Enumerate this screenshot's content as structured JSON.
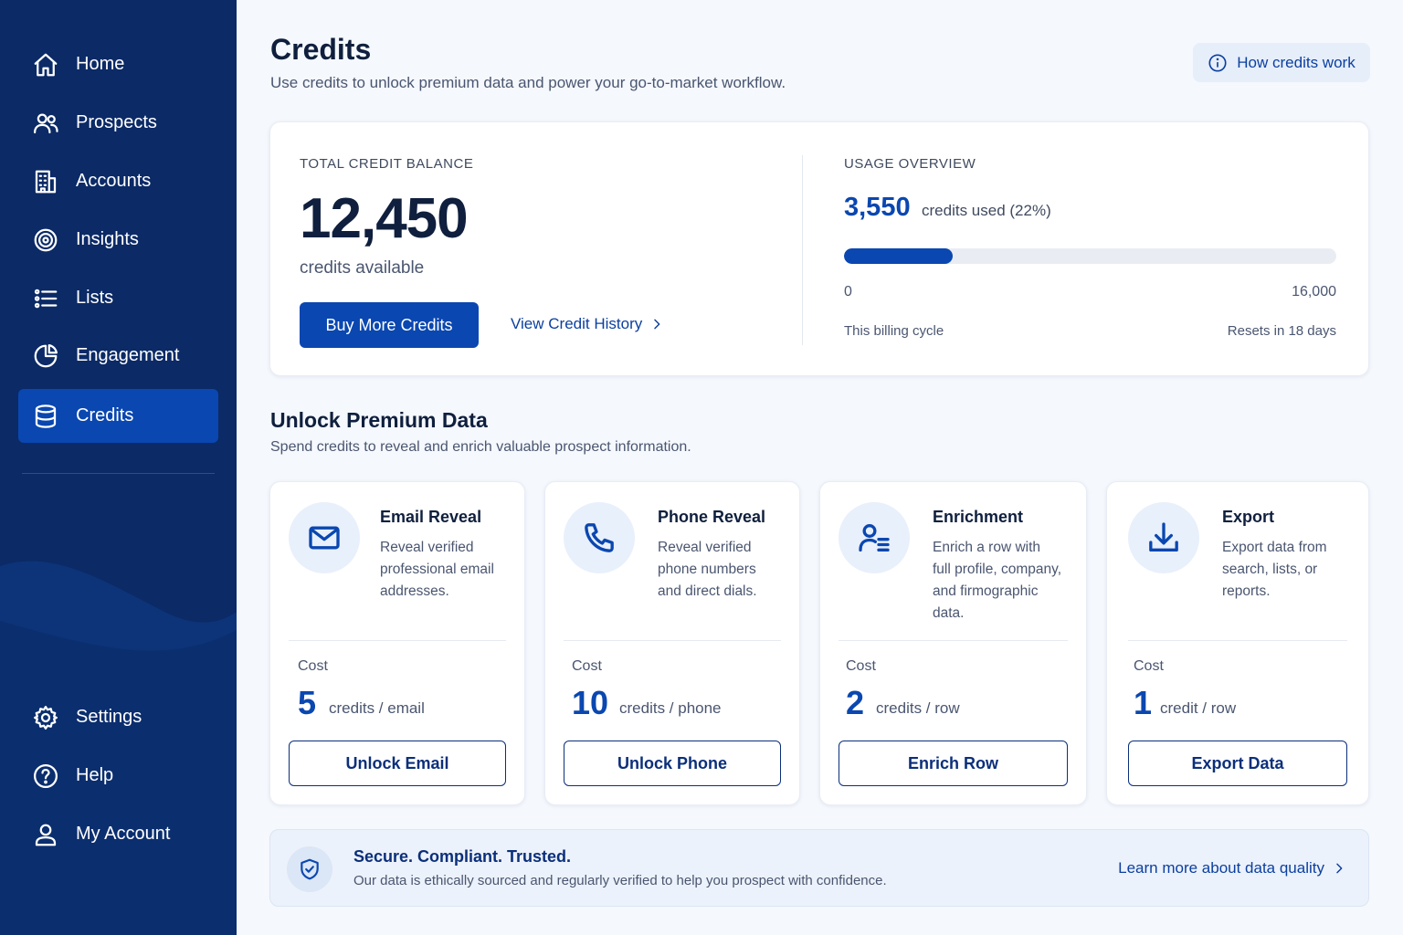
{
  "sidebar": {
    "items": [
      {
        "label": "Home",
        "icon": "home-icon"
      },
      {
        "label": "Prospects",
        "icon": "users-icon"
      },
      {
        "label": "Accounts",
        "icon": "building-icon"
      },
      {
        "label": "Insights",
        "icon": "target-icon"
      },
      {
        "label": "Lists",
        "icon": "list-icon"
      },
      {
        "label": "Engagement",
        "icon": "pie-chart-icon"
      },
      {
        "label": "Credits",
        "icon": "database-icon",
        "active": true
      }
    ],
    "bottom_items": [
      {
        "label": "Settings",
        "icon": "gear-icon"
      },
      {
        "label": "Help",
        "icon": "help-icon"
      },
      {
        "label": "My Account",
        "icon": "user-icon"
      }
    ]
  },
  "header": {
    "title": "Credits",
    "subtitle": "Use credits to unlock premium data and power your go-to-market workflow.",
    "how_button": "How credits work"
  },
  "balance": {
    "label": "TOTAL CREDIT BALANCE",
    "value": "12,450",
    "caption": "credits available",
    "buy_button": "Buy More Credits",
    "history_link": "View Credit History"
  },
  "usage": {
    "label": "USAGE OVERVIEW",
    "used": "3,550",
    "used_text": "credits used (22%)",
    "fraction": 0.22,
    "min": "0",
    "max": "16,000",
    "cycle": "This billing cycle",
    "resets": "Resets in 18 days"
  },
  "section": {
    "title": "Unlock Premium Data",
    "subtitle": "Spend credits to reveal and enrich valuable prospect information."
  },
  "features": [
    {
      "title": "Email Reveal",
      "desc": [
        "Reveal verified",
        "professional email",
        "addresses."
      ],
      "cost_label": "Cost",
      "cost": "5",
      "unit": "credits / email",
      "button": "Unlock Email",
      "icon": "mail-icon"
    },
    {
      "title": "Phone Reveal",
      "desc": [
        "Reveal verified",
        "phone numbers",
        "and direct dials."
      ],
      "cost_label": "Cost",
      "cost": "10",
      "unit": "credits / phone",
      "button": "Unlock Phone",
      "icon": "phone-icon"
    },
    {
      "title": "Enrichment",
      "desc": [
        "Enrich a row with",
        "full profile, company,",
        "and firmographic",
        "data."
      ],
      "cost_label": "Cost",
      "cost": "2",
      "unit": "credits / row",
      "button": "Enrich Row",
      "icon": "user-list-icon"
    },
    {
      "title": "Export",
      "desc": [
        "Export data from",
        "search, lists, or",
        "reports."
      ],
      "cost_label": "Cost",
      "cost": "1",
      "unit": "credit / row",
      "button": "Export Data",
      "icon": "download-icon"
    }
  ],
  "trust": {
    "title": "Secure. Compliant. Trusted.",
    "subtitle": "Our data is ethically sourced and regularly verified to help you prospect with confidence.",
    "link": "Learn more about data quality"
  },
  "colors": {
    "sidebar": "#0b2a66",
    "accent": "#0a47b0",
    "background": "#f5f8fd"
  }
}
